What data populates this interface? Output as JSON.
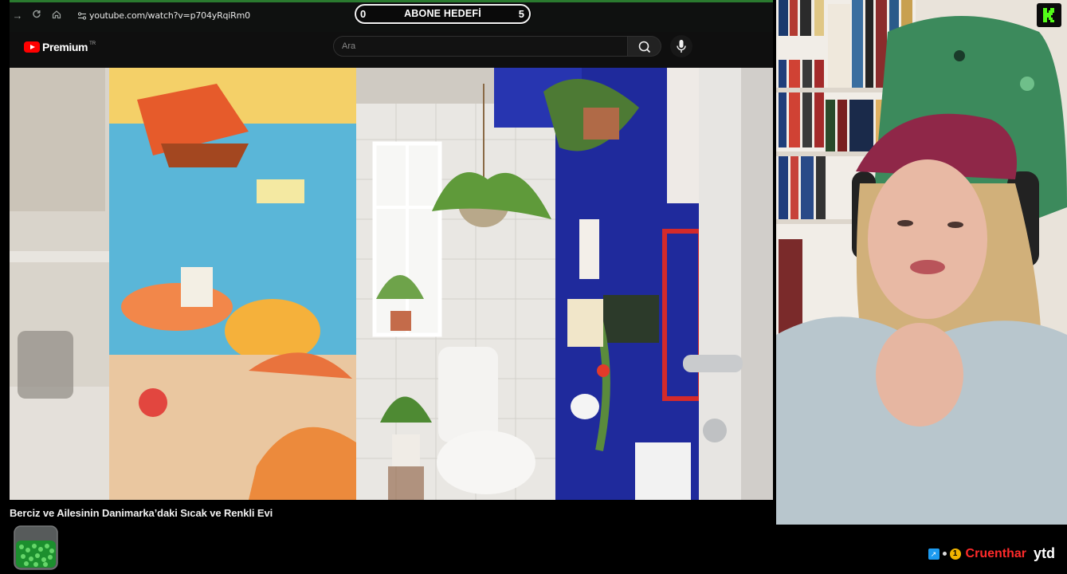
{
  "browser": {
    "url": "youtube.com/watch?v=p704yRqiRm0"
  },
  "goal_overlay": {
    "start": "0",
    "title": "ABONE HEDEFİ",
    "target": "5"
  },
  "youtube": {
    "brand": "Premium",
    "region": "TR",
    "search_placeholder": "Ara",
    "video_title": "Berciz ve Ailesinin Danimarka’daki Sıcak ve Renkli Evi"
  },
  "stream_footer": {
    "name": "Cruenthar",
    "tag": "ytd",
    "coin_label": "1"
  },
  "colors": {
    "yt_red": "#ff0000",
    "goal_border": "#f2f2f2",
    "name_red": "#ff2a2a",
    "kick_green": "#53fc18",
    "wall_blue": "#1f2a9c"
  },
  "icons": [
    "back-arrow-icon",
    "reload-icon",
    "home-icon",
    "site-info-icon",
    "search-icon",
    "mic-icon",
    "x-icon",
    "coin-icon",
    "kick-logo-icon"
  ]
}
